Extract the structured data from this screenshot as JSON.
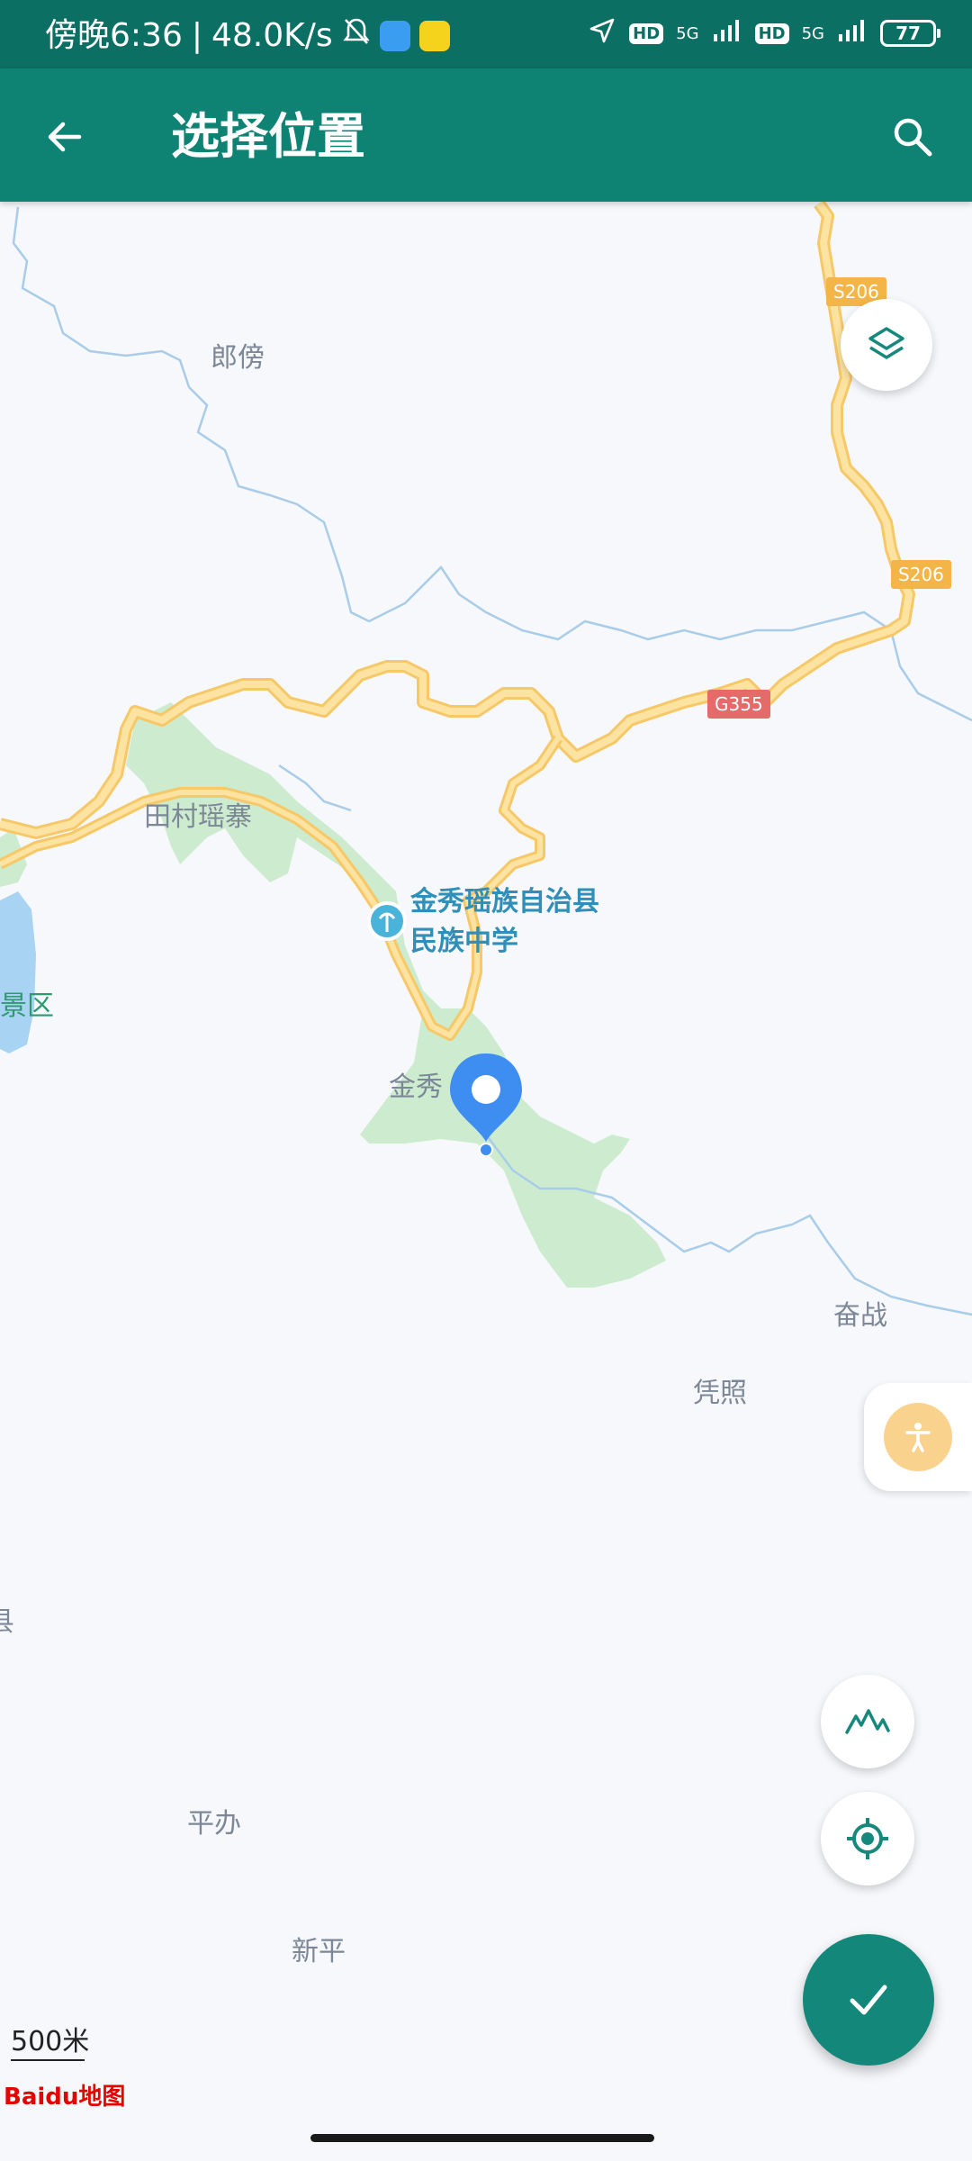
{
  "status_bar": {
    "time": "傍晚6:36",
    "net_speed": "48.0K/s",
    "signal_1": "5G",
    "signal_2": "5G",
    "hd_1": "HD",
    "hd_2": "HD",
    "battery": "77"
  },
  "app_bar": {
    "title": "选择位置"
  },
  "map": {
    "labels": {
      "langbang": "郎傍",
      "tiancun": "田村瑶寨",
      "school_line1": "金秀瑶族自治县",
      "school_line2": "民族中学",
      "scenic": "景区",
      "jinxiu": "金秀",
      "fenzhan": "奋战",
      "pingzhao": "凭照",
      "pingban": "平办",
      "xinping": "新平",
      "left_edge": "县"
    },
    "shields": {
      "s206_top": "S206",
      "s206_mid": "S206",
      "g355": "G355"
    },
    "scale": "500米",
    "logo": "Baidu地图"
  },
  "colors": {
    "accent": "#0e8374",
    "status_bar": "#0b6f63",
    "road": "#fbd98a",
    "green_area": "#cdeccf",
    "pin": "#3d8ef0"
  }
}
